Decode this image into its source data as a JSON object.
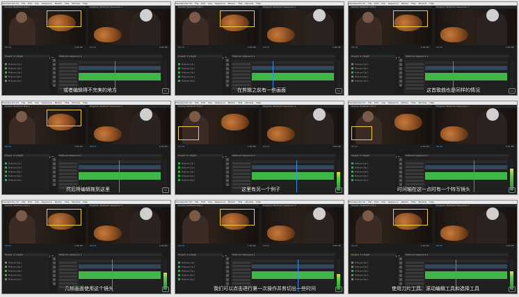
{
  "app": {
    "menu": [
      "Premiere Pro CC",
      "File",
      "Edit",
      "Clip",
      "Sequence",
      "Marker",
      "Title",
      "Window",
      "Help"
    ],
    "source_panel": "Source: Multicam Clip 1",
    "program_panel": "Program: Multicam Sequence 1",
    "project_panel": "Project: 3.1 Right",
    "timeline_panel": "Multicam Sequence 1",
    "timecode_left": "00:18",
    "timecode_right": "1:01:00",
    "project_items": [
      "Multicam Clip 1",
      "Multicam Clip 2",
      "Multicam Clip 3",
      "Multicam Seq 1",
      "Multicam Seq 2"
    ]
  },
  "captions": [
    "或者编辑得不完美的地方",
    "在剪辑之前有一些画面",
    "这首歌曲也是同样的情况",
    "然后将编辑拖到这里",
    "这里有另一个例子",
    "时间轴在这一点时有一个特写镜头",
    "几帧画面使用这个镜头",
    "我们可以点击进行第一次操作并剪切出一些时间",
    "使用刀片工具、滚动编辑工具和选择工具"
  ],
  "cc_label": "CC",
  "colors": {
    "accent_blue": "#3f8fe8",
    "audio_green": "#3fb54a",
    "selection_yellow": "#f2d24a"
  }
}
